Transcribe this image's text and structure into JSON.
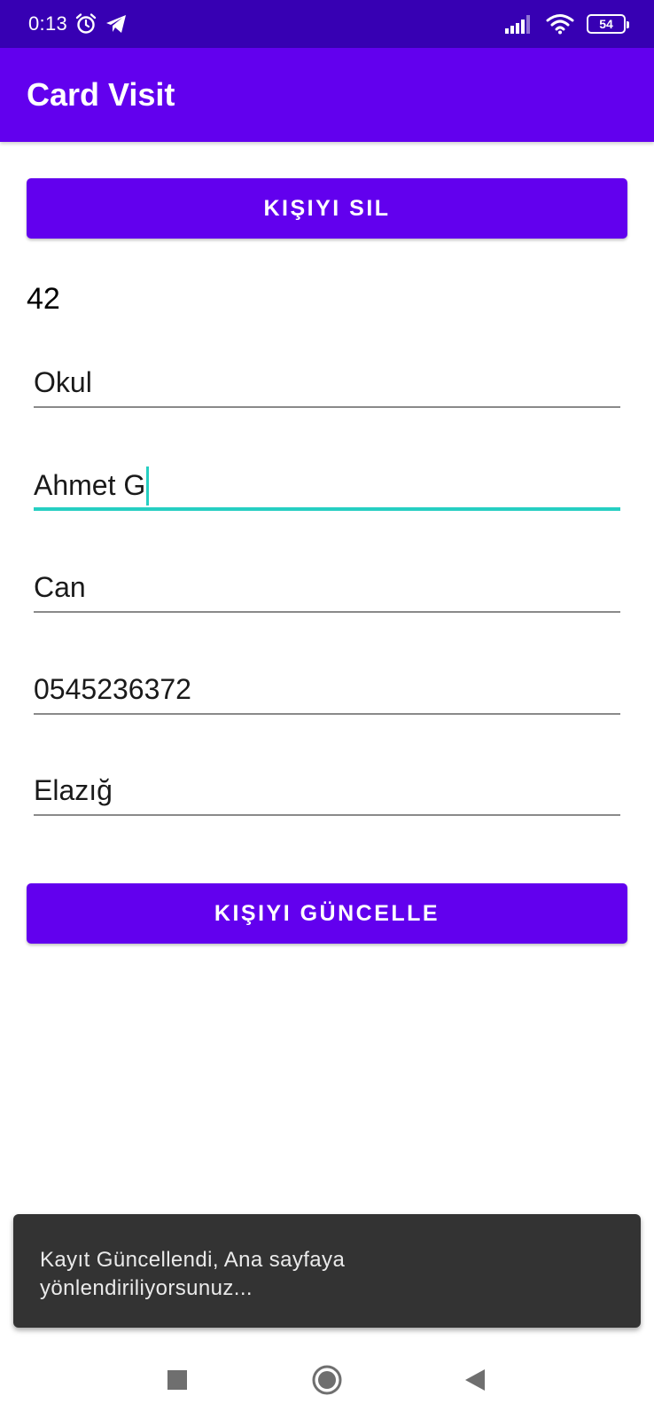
{
  "status_bar": {
    "time": "0:13",
    "battery_level": "54",
    "icons": [
      "alarm-icon",
      "telegram-icon",
      "signal-icon",
      "wifi-icon",
      "battery-icon"
    ]
  },
  "app_bar": {
    "title": "Card Visit"
  },
  "buttons": {
    "delete_label": "Kişiyi Sil",
    "update_label": "Kişiyi Güncelle"
  },
  "record": {
    "id": "42"
  },
  "form": {
    "fields": [
      {
        "value": "Okul",
        "focused": false
      },
      {
        "value": "Ahmet G",
        "focused": true
      },
      {
        "value": "Can",
        "focused": false
      },
      {
        "value": "0545236372",
        "focused": false
      },
      {
        "value": "Elazığ",
        "focused": false
      }
    ]
  },
  "snackbar": {
    "line1": "Kayıt Güncellendi, Ana sayfaya",
    "line2": "yönlendiriliyorsunuz..."
  },
  "nav_bar": {
    "icons": [
      "recents-icon",
      "home-icon",
      "back-icon"
    ]
  },
  "colors": {
    "status_bar": "#3700b3",
    "primary": "#6200ee",
    "accent": "#26cfc2",
    "snackbar": "#333333"
  }
}
